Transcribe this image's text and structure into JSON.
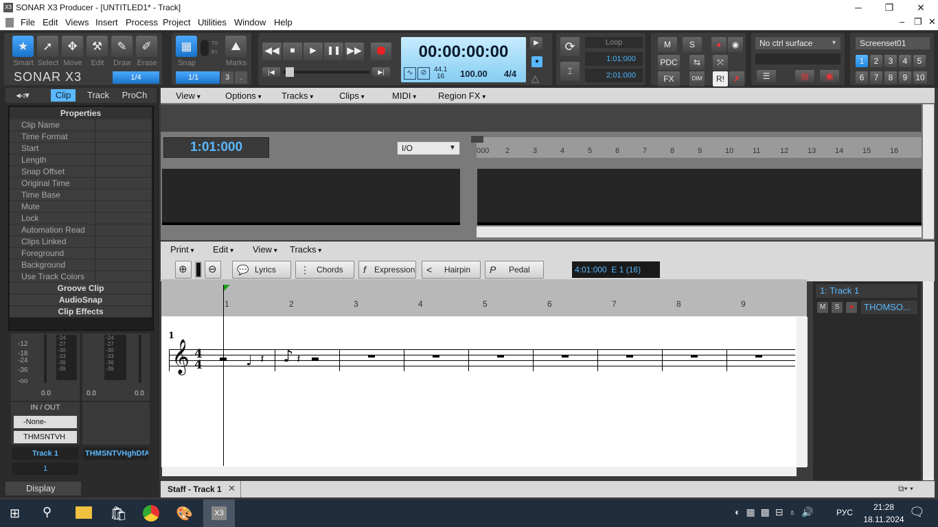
{
  "window": {
    "title": "SONAR X3 Producer - [UNTITLED1* - Track]",
    "app_icon": "X3",
    "min": "─",
    "restore": "❐",
    "close": "✕"
  },
  "menu": [
    "File",
    "Edit",
    "Views",
    "Insert",
    "Process",
    "Project",
    "Utilities",
    "Window",
    "Help"
  ],
  "mdi": {
    "min": "–",
    "restore": "❐",
    "close": "✕"
  },
  "tools": {
    "smart": "Smart",
    "select": "Select",
    "move": "Move",
    "edit": "Edit",
    "draw": "Draw",
    "erase": "Erase",
    "snap": "Snap",
    "marks": "Marks",
    "logo": "SONAR X3",
    "snap_val": "1/4",
    "snap_grid": "1/1",
    "snap_num": "3",
    "snap_dot": ".",
    "to": "TO",
    "by": "BY"
  },
  "transport": {
    "time": "00:00:00:00",
    "rate_top": "44.1",
    "rate_bot": "16",
    "tempo": "100.00",
    "meter": "4/4"
  },
  "loop": {
    "label": "Loop",
    "start": "1:01:000",
    "end": "2:01:000"
  },
  "mix": {
    "m": "M",
    "s": "S",
    "pdc": "PDC",
    "fx": "FX",
    "dim": "DIM",
    "ri": "R!"
  },
  "ctrl": {
    "surface": "No ctrl surface"
  },
  "screenset": {
    "name": "Screenset01",
    "nums": [
      "1",
      "2",
      "3",
      "4",
      "5",
      "6",
      "7",
      "8",
      "9",
      "10"
    ]
  },
  "leftpane": {
    "tabs": [
      "Clip",
      "Track",
      "ProCh"
    ],
    "header": "Properties",
    "props": [
      "Clip Name",
      "Time Format",
      "Start",
      "Length",
      "Snap Offset",
      "Original Time",
      "Time Base",
      "Mute",
      "Lock",
      "Automation Read",
      "Clips Linked",
      "Foreground",
      "Background",
      "Use Track Colors"
    ],
    "sections": [
      "Groove Clip",
      "AudioSnap",
      "Clip Effects"
    ],
    "meter_scale": [
      "-12",
      "-18",
      "-24",
      "-36",
      "-oo"
    ],
    "meter_scale2": [
      "-24",
      "-27",
      "-30",
      "-33",
      "-36",
      "-39"
    ],
    "vol1": "0.0",
    "vol2": "0.0",
    "vol3": "0.0",
    "io": "IN / OUT",
    "input": "-None-",
    "output": "THMSNTVH",
    "track": "Track 1",
    "track_num": "1",
    "bus": "THMSNTVHghDfA",
    "display": "Display"
  },
  "trackview": {
    "menus": [
      "View",
      "Options",
      "Tracks",
      "Clips",
      "MIDI",
      "Region FX"
    ],
    "now": "1:01:000",
    "io": "I/O",
    "ruler": [
      "000",
      "2",
      "3",
      "4",
      "5",
      "6",
      "7",
      "8",
      "9",
      "10",
      "11",
      "12",
      "13",
      "14",
      "15",
      "16"
    ]
  },
  "staff": {
    "menus": [
      "Print",
      "Edit",
      "View",
      "Tracks"
    ],
    "buttons": [
      "Lyrics",
      "Chords",
      "Expression",
      "Hairpin",
      "Pedal"
    ],
    "status": "4:01:000  E 1 (16)",
    "ruler": [
      "1",
      "2",
      "3",
      "4",
      "5",
      "6",
      "7",
      "8",
      "9"
    ],
    "measure": "1",
    "time_top": "4",
    "time_bot": "4",
    "track_name": "1: Track 1",
    "tm": "M",
    "ts": "S",
    "out": "THOMSO...",
    "tab": "Staff - Track 1",
    "tab_close": "✕"
  },
  "taskbar": {
    "time": "21:28",
    "date": "18.11.2024",
    "lang": "РУС"
  }
}
